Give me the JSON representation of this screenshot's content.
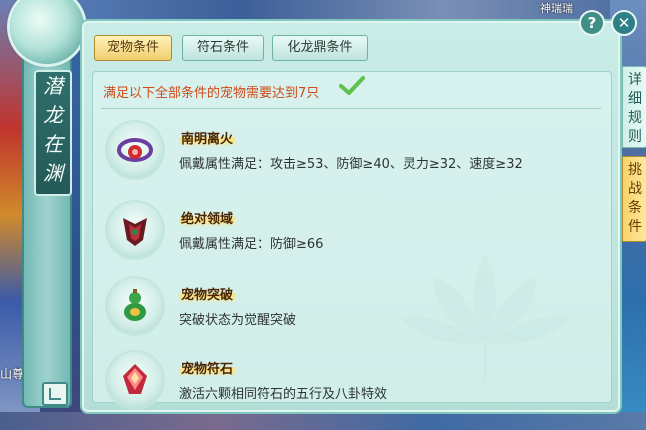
{
  "background": {
    "left_label": "山尊",
    "top_right_label": "神瑞瑞"
  },
  "side_panel": {
    "title_chars": [
      "潜",
      "龙",
      "在",
      "渊"
    ]
  },
  "tabs": [
    {
      "label": "宠物条件",
      "active": true
    },
    {
      "label": "符石条件",
      "active": false
    },
    {
      "label": "化龙鼎条件",
      "active": false
    }
  ],
  "requirement": {
    "text": "满足以下全部条件的宠物需要达到7只",
    "status": "met"
  },
  "conditions": [
    {
      "name": "南明离火",
      "description": "佩戴属性满足：攻击≥53、防御≥40、灵力≥32、速度≥32",
      "icon": "red-gem-ring-icon"
    },
    {
      "name": "绝对领域",
      "description": "佩戴属性满足：防御≥66",
      "icon": "dark-red-armor-icon"
    },
    {
      "name": "宠物突破",
      "description": "突破状态为觉醒突破",
      "icon": "green-gourd-icon"
    },
    {
      "name": "宠物符石",
      "description": "激活六颗相同符石的五行及八卦特效",
      "icon": "red-rune-crystal-icon"
    }
  ],
  "side_tabs": [
    {
      "chars": [
        "详",
        "细",
        "规",
        "则"
      ],
      "active": false
    },
    {
      "chars": [
        "挑",
        "战",
        "条",
        "件"
      ],
      "active": true
    }
  ],
  "buttons": {
    "help": "?",
    "close": "✕"
  },
  "colors": {
    "requirement_text": "#d04a17",
    "active_tab": "#f1cf70",
    "panel_bg": "#c9ece6"
  }
}
